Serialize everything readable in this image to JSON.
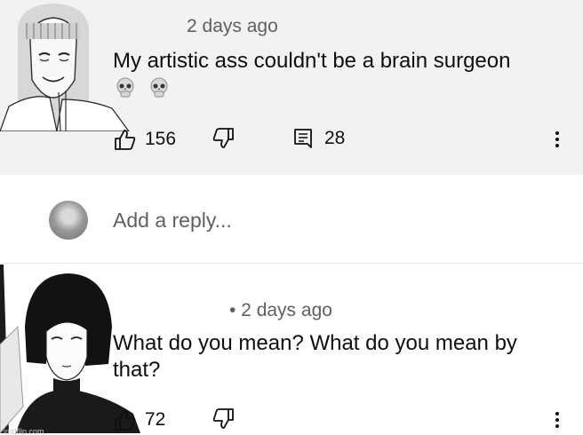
{
  "top_comment": {
    "timestamp": "2 days ago",
    "text": "My  artistic  ass couldn't be a brain surgeon",
    "emojis": [
      "skull-icon",
      "skull-icon"
    ],
    "likes": "156",
    "replies": "28"
  },
  "reply_box": {
    "placeholder": "Add a reply..."
  },
  "bottom_comment": {
    "timestamp": "• 2 days ago",
    "text": "What do you mean? What do you mean by that?",
    "likes": "72"
  },
  "watermark": "imgflip.com"
}
